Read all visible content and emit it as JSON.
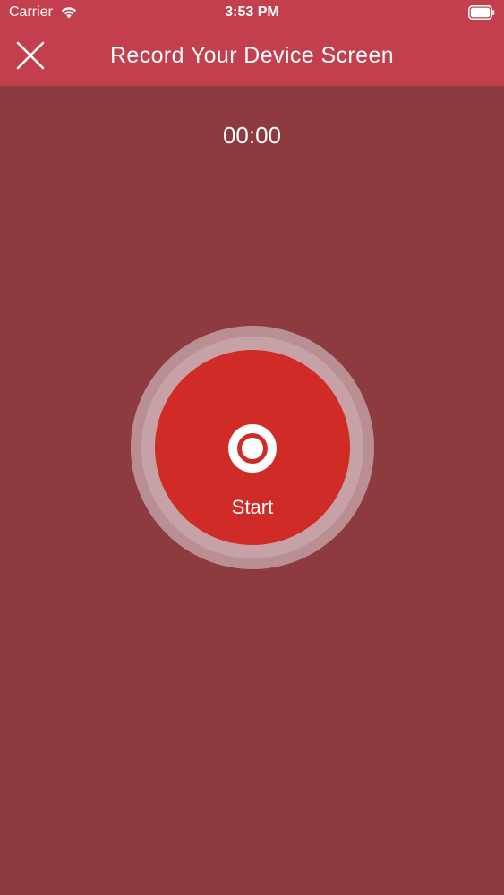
{
  "status_bar": {
    "carrier": "Carrier",
    "time": "3:53 PM",
    "wifi_icon": "wifi-icon",
    "battery_icon": "battery-icon"
  },
  "nav": {
    "title": "Record Your Device Screen",
    "close_icon": "close-icon",
    "background_color": "#c43f4d"
  },
  "timer": {
    "value": "00:00"
  },
  "record_button": {
    "label": "Start",
    "icon": "record-icon",
    "color": "#d02b26"
  },
  "colors": {
    "page_background": "#8e3b40",
    "ring": "#c6a1a5",
    "text": "#ffffff"
  }
}
